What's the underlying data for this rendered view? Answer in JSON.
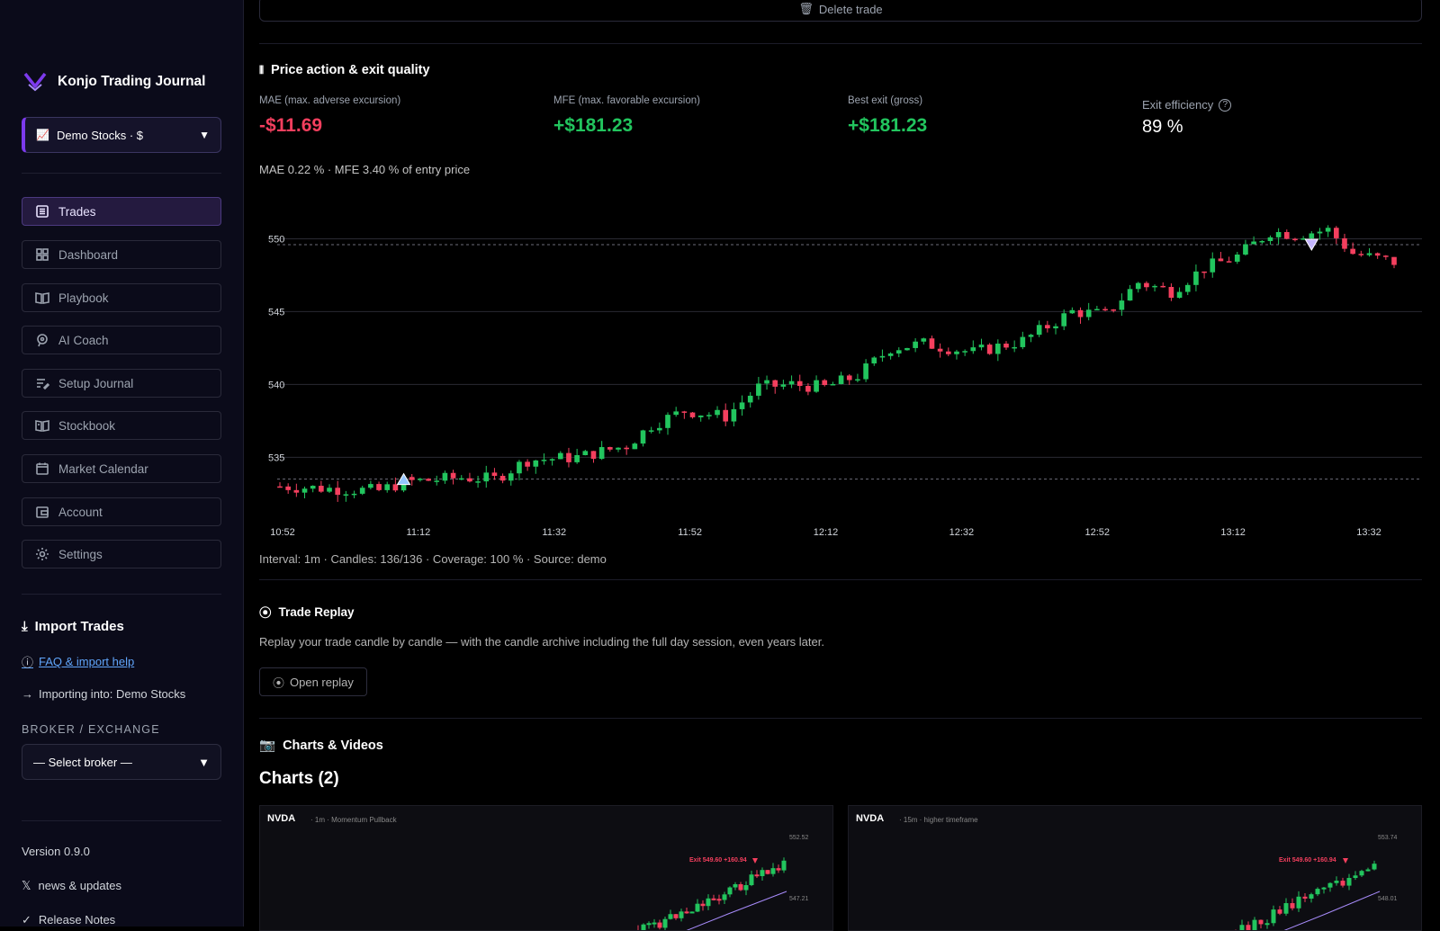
{
  "sidebar": {
    "brand": "Konjo Trading Journal",
    "account": "Demo Stocks · $",
    "nav": [
      {
        "label": "Trades",
        "icon": "list-icon",
        "active": true
      },
      {
        "label": "Dashboard",
        "icon": "dashboard-icon"
      },
      {
        "label": "Playbook",
        "icon": "book-open-icon"
      },
      {
        "label": "AI Coach",
        "icon": "ai-coach-icon"
      },
      {
        "label": "Setup Journal",
        "icon": "journal-edit-icon"
      },
      {
        "label": "Stockbook",
        "icon": "stockbook-icon"
      },
      {
        "label": "Market Calendar",
        "icon": "calendar-icon"
      },
      {
        "label": "Account",
        "icon": "wallet-icon"
      },
      {
        "label": "Settings",
        "icon": "gear-icon"
      }
    ],
    "import_title": "Import Trades",
    "faq_link": "FAQ & import help",
    "importing_into": "Importing into: Demo Stocks",
    "broker_label": "BROKER / EXCHANGE",
    "broker_placeholder": "— Select broker —",
    "version": "Version 0.9.0",
    "news": "news & updates",
    "release_notes": "Release Notes"
  },
  "main": {
    "delete_trade": "Delete trade",
    "price_action_title": "Price action & exit quality",
    "metrics": {
      "mae_label": "MAE (max. adverse excursion)",
      "mae_value": "-$11.69",
      "mfe_label": "MFE (max. favorable excursion)",
      "mfe_value": "+$181.23",
      "best_exit_label": "Best exit (gross)",
      "best_exit_value": "+$181.23",
      "exit_eff_label": "Exit efficiency",
      "exit_eff_value": "89 %"
    },
    "mae_sub": "MAE 0.22 % · MFE 3.40 % of entry price",
    "chart_footer": "Interval: 1m · Candles: 136/136 · Coverage: 100 % · Source: demo",
    "replay_title": "Trade Replay",
    "replay_desc": "Replay your trade candle by candle — with the candle archive including the full day session, even years later.",
    "replay_button": "Open replay",
    "charts_videos_title": "Charts & Videos",
    "charts_heading": "Charts (2)",
    "thumbs": [
      {
        "title": "NVDA",
        "sub": "· 1m · Momentum Pullback",
        "exit": "Exit 549.60 +160.94",
        "hi": "552.52",
        "lo": "547.21"
      },
      {
        "title": "NVDA",
        "sub": "· 15m · higher timeframe",
        "exit": "Exit 549.60 +160.94",
        "hi": "553.74",
        "lo": "548.01"
      }
    ]
  },
  "colors": {
    "up": "#22c55e",
    "down": "#f43f5e",
    "accent": "#7c3aed"
  },
  "chart_data": {
    "type": "candlestick",
    "x_ticks": [
      "10:52",
      "11:12",
      "11:32",
      "11:52",
      "12:12",
      "12:32",
      "12:52",
      "13:12",
      "13:32"
    ],
    "y_ticks": [
      535,
      540,
      545,
      550
    ],
    "ylim": [
      531.5,
      552.5
    ],
    "entry_price": 533.5,
    "exit_price": 549.6,
    "entry_time": "11:07",
    "exit_time": "13:20",
    "candles": 136,
    "close_path": [
      {
        "t": 0,
        "p": 533.0
      },
      {
        "t": 12,
        "p": 532.7
      },
      {
        "t": 15,
        "p": 533.3
      },
      {
        "t": 22,
        "p": 533.6
      },
      {
        "t": 26,
        "p": 533.5
      },
      {
        "t": 30,
        "p": 534.8
      },
      {
        "t": 36,
        "p": 535.0
      },
      {
        "t": 42,
        "p": 535.8
      },
      {
        "t": 45,
        "p": 537.2
      },
      {
        "t": 49,
        "p": 538.2
      },
      {
        "t": 54,
        "p": 537.8
      },
      {
        "t": 58,
        "p": 539.8
      },
      {
        "t": 62,
        "p": 540.0
      },
      {
        "t": 66,
        "p": 539.8
      },
      {
        "t": 70,
        "p": 540.6
      },
      {
        "t": 74,
        "p": 542.5
      },
      {
        "t": 78,
        "p": 542.8
      },
      {
        "t": 84,
        "p": 542.2
      },
      {
        "t": 90,
        "p": 543.0
      },
      {
        "t": 96,
        "p": 545.0
      },
      {
        "t": 100,
        "p": 544.8
      },
      {
        "t": 104,
        "p": 547.0
      },
      {
        "t": 108,
        "p": 546.4
      },
      {
        "t": 112,
        "p": 548.0
      },
      {
        "t": 116,
        "p": 548.8
      },
      {
        "t": 120,
        "p": 550.5
      },
      {
        "t": 123,
        "p": 550.3
      },
      {
        "t": 127,
        "p": 550.6
      },
      {
        "t": 130,
        "p": 549.0
      },
      {
        "t": 135,
        "p": 548.4
      }
    ]
  }
}
